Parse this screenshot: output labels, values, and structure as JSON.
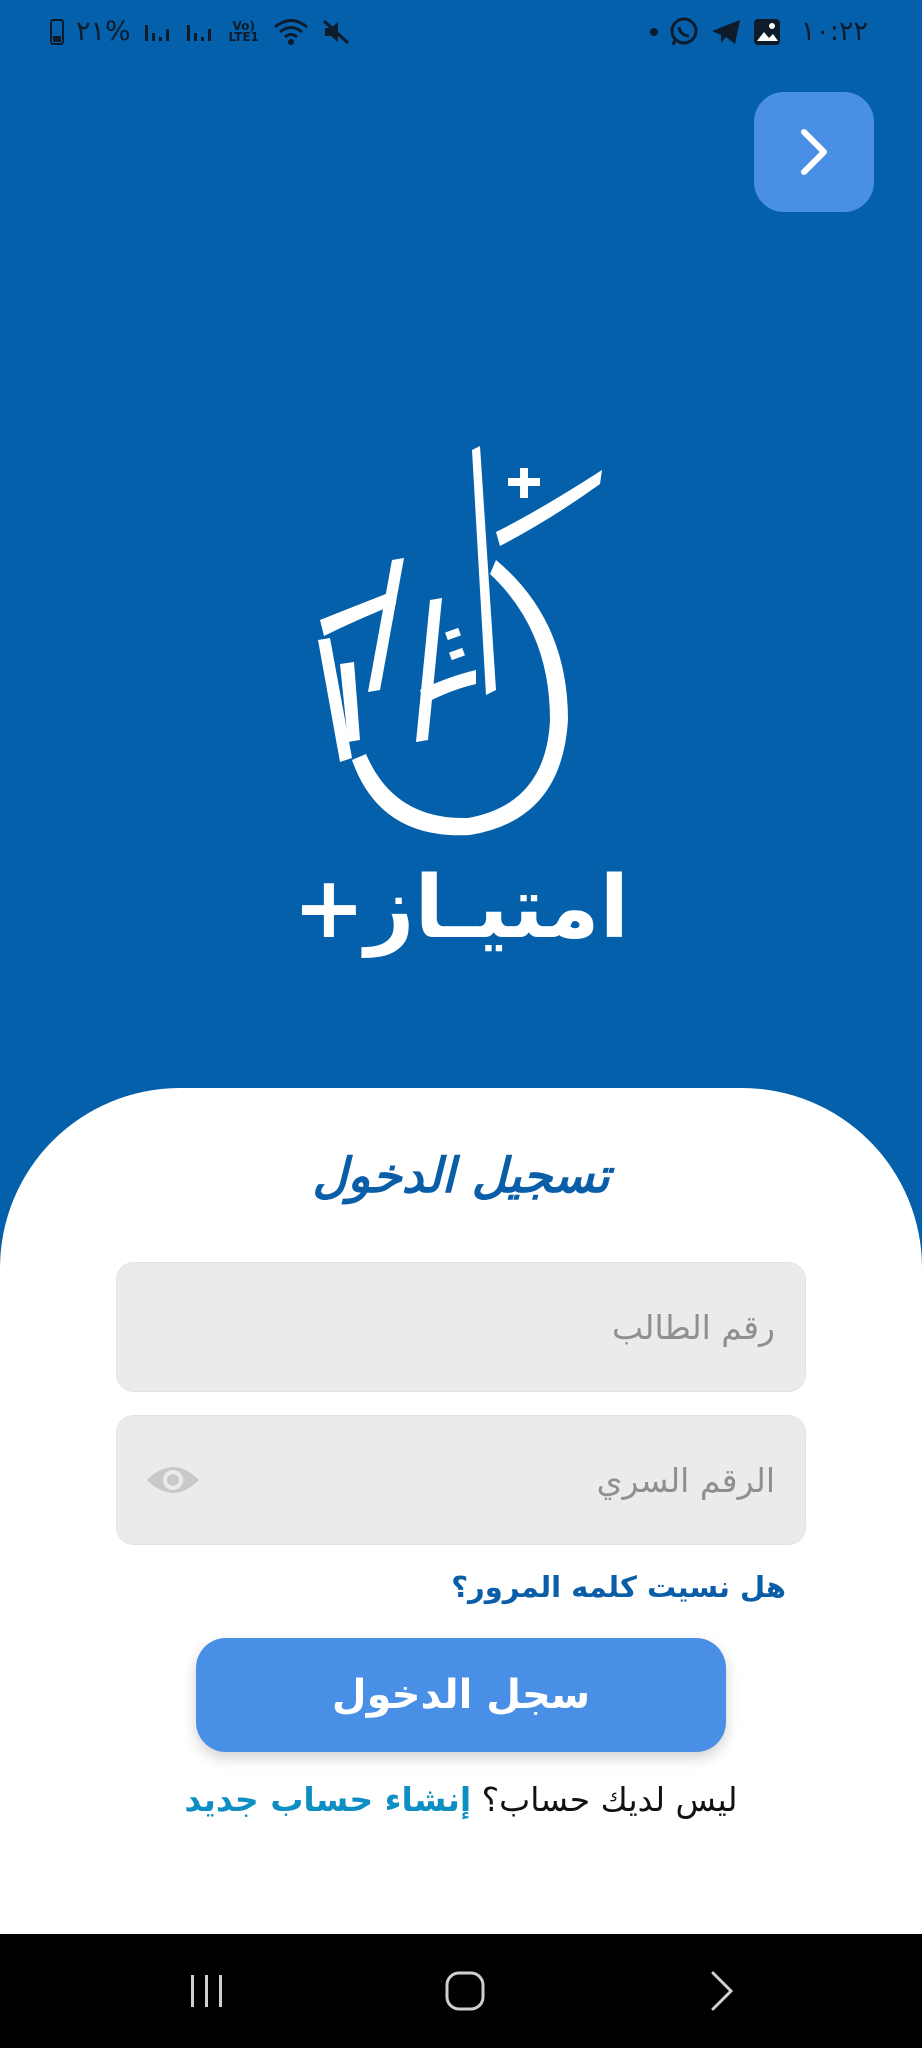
{
  "status_bar": {
    "time": "١٠:٢٢",
    "battery": "%٢١",
    "network_label": "Vo) LTE1"
  },
  "logo": {
    "text": "امتيـاز+",
    "icon": "imtiaz-calligraphy-logo"
  },
  "login": {
    "title": "تسجيل الدخول",
    "student_number_placeholder": "رقم الطالب",
    "password_placeholder": "الرقم السري",
    "forgot_password": "هل نسيت كلمه المرور؟",
    "submit_label": "سجل الدخول",
    "no_account": "ليس لديك حساب؟ ",
    "create_account": "إنشاء حساب جديد"
  },
  "colors": {
    "background": "#0560ab",
    "accent": "#4a8fe6",
    "title": "#0a5ea8",
    "link": "#0d8fc4"
  }
}
